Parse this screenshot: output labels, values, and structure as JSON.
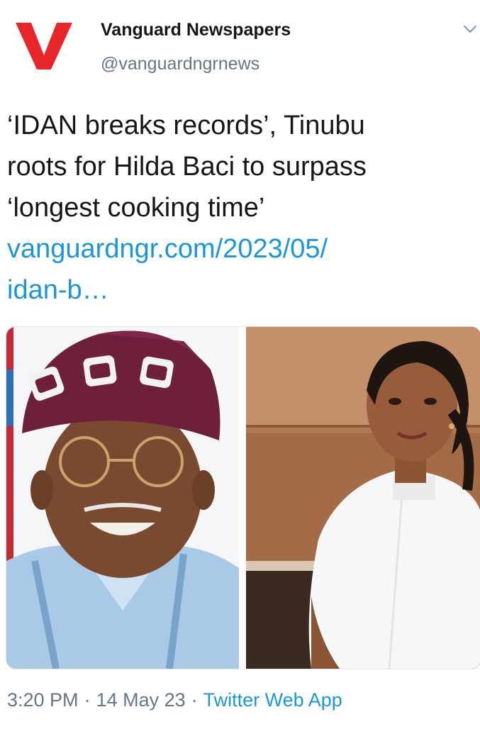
{
  "author": {
    "display_name": "Vanguard Newspapers",
    "handle": "@vanguardngrnews",
    "avatar_letter": "V",
    "avatar_color": "#e8262a"
  },
  "tweet": {
    "text_lines": [
      "‘IDAN breaks records’, Tinubu",
      "roots for Hilda Baci to surpass",
      "‘longest cooking time’"
    ],
    "link_lines": [
      "vanguardngr.com/2023/05/",
      "idan-b…"
    ]
  },
  "media": {
    "left_icon": "man-in-cap-photo",
    "right_icon": "woman-chef-photo"
  },
  "meta": {
    "time": "3:20 PM",
    "separator": "·",
    "date": "14 May 23",
    "source": "Twitter Web App"
  },
  "colors": {
    "link": "#1b95e0",
    "secondary_text": "#657786",
    "primary_text": "#14171a"
  }
}
